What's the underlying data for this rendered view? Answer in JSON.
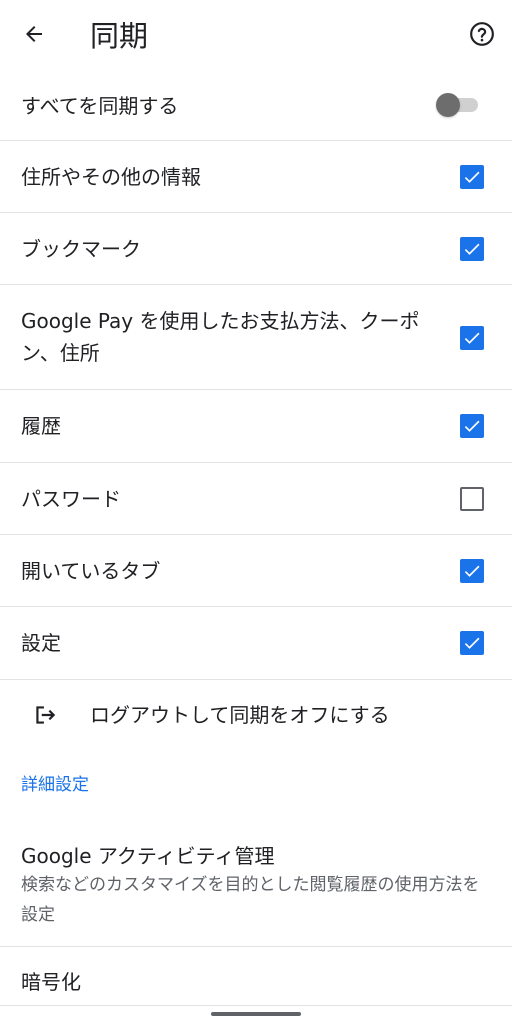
{
  "appbar": {
    "title": "同期",
    "back_icon": "arrow-back-icon",
    "help_icon": "help-circle-icon"
  },
  "sync_all": {
    "label": "すべてを同期する",
    "enabled": false
  },
  "items": [
    {
      "label": "住所やその他の情報",
      "checked": true
    },
    {
      "label": "ブックマーク",
      "checked": true
    },
    {
      "label": "Google Pay を使用したお支払方法、クーポン、住所",
      "checked": true
    },
    {
      "label": "履歴",
      "checked": true
    },
    {
      "label": "パスワード",
      "checked": false
    },
    {
      "label": "開いているタブ",
      "checked": true
    },
    {
      "label": "設定",
      "checked": true
    }
  ],
  "signout": {
    "label": "ログアウトして同期をオフにする",
    "icon": "logout-icon"
  },
  "advanced": {
    "header": "詳細設定",
    "activity_title": "Google アクティビティ管理",
    "activity_desc": "検索などのカスタマイズを目的とした閲覧履歴の使用方法を設定",
    "encryption_label": "暗号化"
  },
  "colors": {
    "accent": "#1a73e8",
    "text": "#202124",
    "secondary": "#5f6368"
  }
}
